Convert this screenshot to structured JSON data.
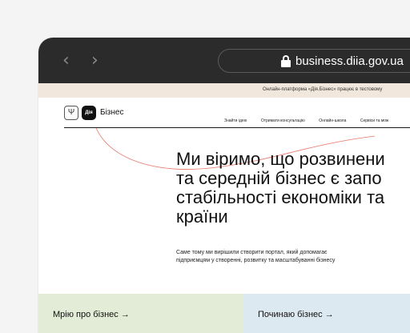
{
  "browser": {
    "url": "business.diia.gov.ua",
    "back_icon": "chevron-left-icon",
    "forward_icon": "chevron-right-icon",
    "lock_icon": "lock-icon"
  },
  "notice": {
    "text": "Онлайн-платформа «Дія.Бізнес» працює в тестовому"
  },
  "header": {
    "trident_glyph": "Ψ",
    "logo_text": "Дія",
    "brand": "Бізнес",
    "menu": [
      "Знайти ідею",
      "Отримати консультацію",
      "Онлайн-школа",
      "Сервіси та мож"
    ]
  },
  "hero": {
    "title_lines": [
      "Ми віримо, що розвинени",
      "та середній бізнес є запо",
      "стабільності економіки та",
      "країни"
    ],
    "subtitle": "Саме тому ми вирішили створити портал, який допомагає підприємцям у створенні, розвитку та масштабуванні бізнесу"
  },
  "cards": {
    "dream": "Мрію про бізнес →",
    "start": "Починаю бізнес →"
  },
  "colors": {
    "chrome": "#2b2b2b",
    "notice_bg": "#f1e7dc",
    "accent_line": "#e8776a",
    "card_dream": "#e3ecd6",
    "card_start": "#dde9f0"
  }
}
